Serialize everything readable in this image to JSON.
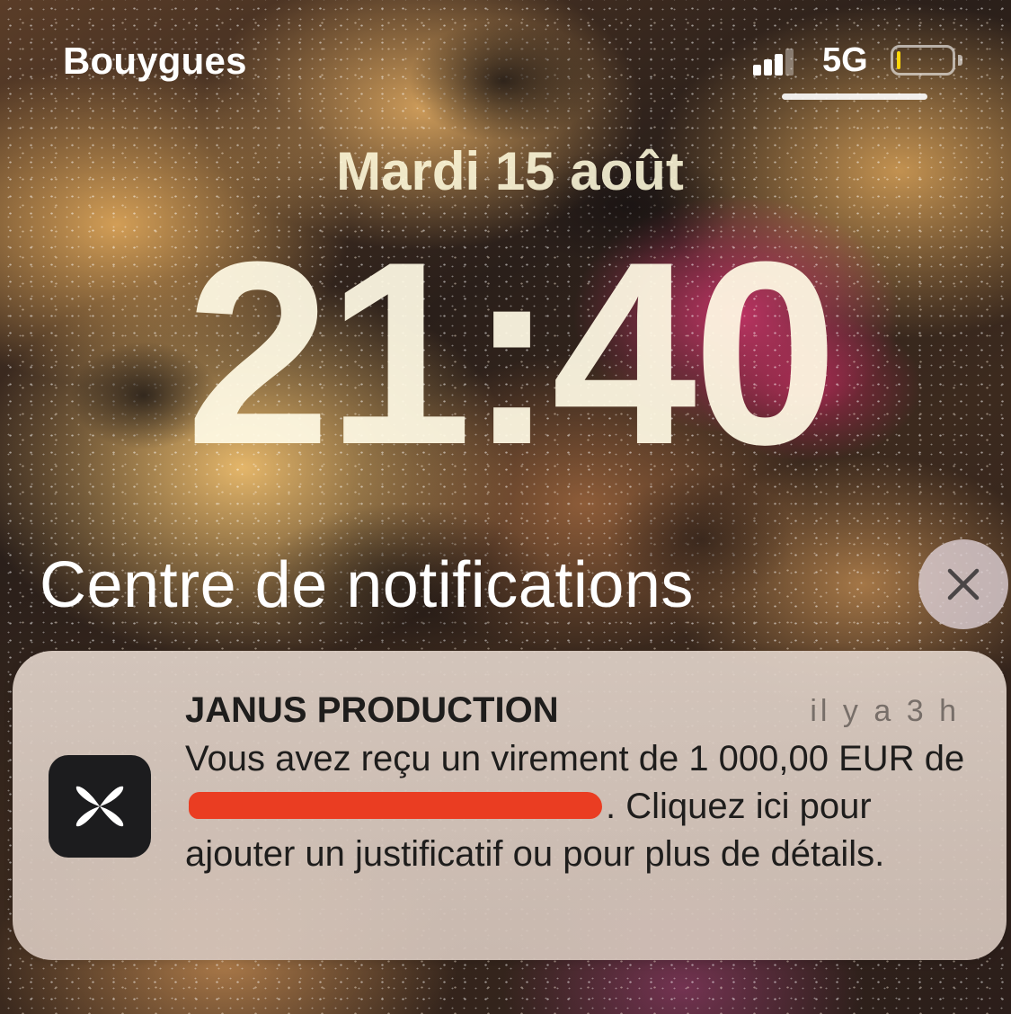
{
  "status_bar": {
    "carrier": "Bouygues",
    "network": "5G",
    "battery_level": 0.05,
    "battery_color": "#ffd60a",
    "signal_bars_active": 3,
    "signal_bars_total": 4
  },
  "lock_screen": {
    "date": "Mardi 15 août",
    "time": "21:40"
  },
  "notification_center": {
    "title": "Centre de notifications",
    "clear_icon": "close-icon"
  },
  "notification": {
    "app_name": "JANUS PRODUCTION",
    "timestamp": "il y a 3 h",
    "app_icon": "qonto-flower-icon",
    "body_before_redaction": "Vous avez reçu un virement de 1 000,00 EUR de",
    "body_after_redaction": ". Cliquez ici pour ajouter un justificatif ou pour plus de détails.",
    "redaction_color": "#ea3d22"
  }
}
